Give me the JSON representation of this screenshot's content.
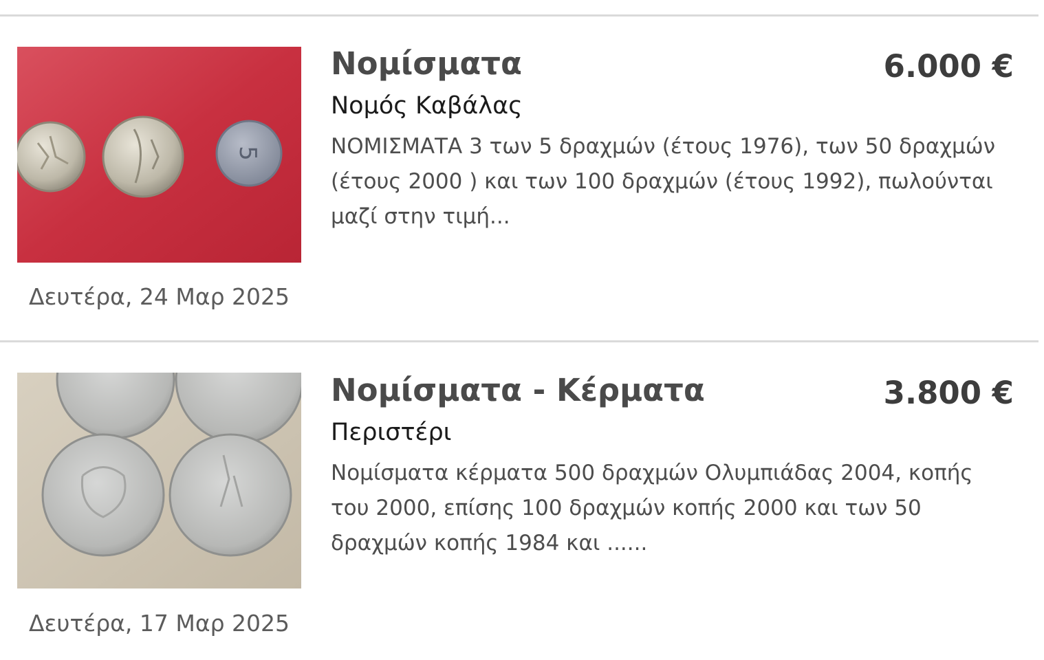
{
  "listings": [
    {
      "title": "Νομίσματα",
      "price": "6.000 €",
      "location": "Νομός Καβάλας",
      "description_lines": [
        "ΝΟΜΙΣΜΑΤΑ 3 των 5 δραχμών (έτους 1976), των 50 δραχμών",
        "(έτους 2000 ) και των 100 δραχμών (έτους 1992), πωλούνται",
        "μαζί στην τιμή..."
      ],
      "date": "Δευτέρα, 24 Μαρ 2025",
      "image_icon": "coins-on-red-photo",
      "image_background": "#c8323f"
    },
    {
      "title": "Νομίσματα - Κέρματα",
      "price": "3.800 €",
      "location": "Περιστέρι",
      "description_lines": [
        "Νομίσματα κέρματα 500 δραχμών Ολυμπιάδας 2004, κοπής",
        "του 2000, επίσης 100 δραχμών κοπής 2000 και των 50",
        "δραχμών κοπής 1984 και ......"
      ],
      "date": "Δευτέρα, 17 Μαρ 2025",
      "image_icon": "coins-on-beige-photo",
      "image_background": "#cfc6b5"
    }
  ]
}
